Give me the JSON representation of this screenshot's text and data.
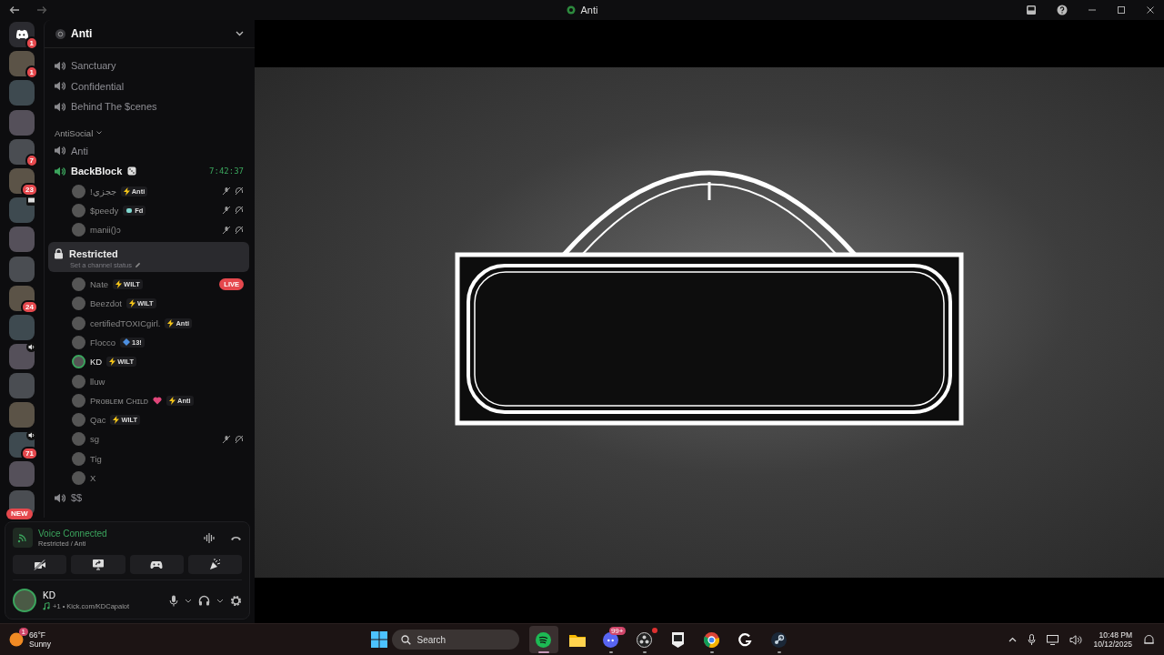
{
  "window": {
    "title": "Anti"
  },
  "servers": [
    {
      "kind": "home",
      "badge": "1",
      "speaker": false,
      "screen": false
    },
    {
      "kind": "server",
      "badge": "1",
      "speaker": false,
      "screen": false
    },
    {
      "kind": "server",
      "speaker": false,
      "screen": false
    },
    {
      "kind": "server",
      "speaker": false,
      "screen": false
    },
    {
      "kind": "server",
      "badge": "7",
      "speaker": false,
      "screen": false
    },
    {
      "kind": "server",
      "badge": "23",
      "speaker": false,
      "screen": false
    },
    {
      "kind": "server",
      "speaker": false,
      "screen": true
    },
    {
      "kind": "server",
      "speaker": false,
      "screen": false
    },
    {
      "kind": "server",
      "speaker": false,
      "screen": false
    },
    {
      "kind": "server",
      "badge": "24",
      "speaker": false,
      "screen": false
    },
    {
      "kind": "server",
      "speaker": false,
      "screen": false
    },
    {
      "kind": "server",
      "speaker": true,
      "screen": false
    },
    {
      "kind": "server",
      "speaker": false,
      "screen": false
    },
    {
      "kind": "server",
      "speaker": false,
      "screen": false
    },
    {
      "kind": "server",
      "badge": "71",
      "speaker": true,
      "screen": false
    },
    {
      "kind": "server",
      "speaker": false,
      "screen": false
    },
    {
      "kind": "server",
      "speaker": false,
      "screen": false,
      "tag": "NEW"
    }
  ],
  "server_header": {
    "name": "Anti"
  },
  "channels": [
    {
      "kind": "voice",
      "name": "Sanctuary",
      "selected": false,
      "active": false,
      "locked": false,
      "die": false
    },
    {
      "kind": "voice",
      "name": "Confidential",
      "selected": false,
      "active": false,
      "locked": false,
      "die": false
    },
    {
      "kind": "voice",
      "name": "Behind The $cenes",
      "selected": false,
      "active": false,
      "locked": false,
      "die": false
    },
    {
      "kind": "category",
      "name": "AntiSocial"
    },
    {
      "kind": "voice",
      "name": "Anti",
      "selected": false,
      "active": false,
      "locked": false,
      "die": false
    },
    {
      "kind": "voice",
      "name": "BackBlock",
      "timer": "7:42:37",
      "selected": false,
      "active": true,
      "locked": false,
      "die": true,
      "users": [
        {
          "name": "!ججزي",
          "tag": {
            "kind": "bolt",
            "text": "Anti"
          },
          "muted": true,
          "speaking": false,
          "heart": false
        },
        {
          "name": "$peedy",
          "tag": {
            "kind": "hand",
            "text": "Fd"
          },
          "muted": true,
          "speaking": false,
          "heart": false
        },
        {
          "name": "manii()ɔ",
          "muted": true,
          "speaking": false,
          "heart": false
        }
      ]
    },
    {
      "kind": "voice",
      "name": "Restricted",
      "status_hint": "Set a channel status",
      "selected": true,
      "active": false,
      "locked": true,
      "die": false,
      "users": [
        {
          "name": "Nate",
          "tag": {
            "kind": "bolt",
            "text": "WILT"
          },
          "status": "LIVE",
          "muted": false,
          "speaking": false,
          "heart": false
        },
        {
          "name": "Beezdot",
          "tag": {
            "kind": "bolt",
            "text": "WILT"
          },
          "muted": false,
          "speaking": false,
          "heart": false
        },
        {
          "name": "certifiedTOXICgirl.",
          "tag": {
            "kind": "bolt",
            "text": "Anti"
          },
          "muted": false,
          "speaking": false,
          "heart": false
        },
        {
          "name": "Flocco",
          "tag": {
            "kind": "diamond",
            "text": "13!"
          },
          "muted": false,
          "speaking": false,
          "heart": false
        },
        {
          "name": "KD",
          "tag": {
            "kind": "bolt",
            "text": "WILT"
          },
          "muted": false,
          "speaking": true,
          "heart": false
        },
        {
          "name": "lluw",
          "muted": false,
          "speaking": false,
          "heart": false
        },
        {
          "name": "Pʀᴏʙʟᴇᴍ Cʜɪʟᴅ",
          "tag": {
            "kind": "bolt",
            "text": "Anti"
          },
          "muted": false,
          "speaking": false,
          "heart": true
        },
        {
          "name": "Qac",
          "tag": {
            "kind": "bolt",
            "text": "WILT"
          },
          "muted": false,
          "speaking": false,
          "heart": false
        },
        {
          "name": "sg",
          "muted": true,
          "speaking": false,
          "heart": false
        },
        {
          "name": "Tig",
          "muted": false,
          "speaking": false,
          "heart": false
        },
        {
          "name": "X",
          "muted": false,
          "speaking": false,
          "heart": false
        }
      ]
    },
    {
      "kind": "voice",
      "name": "$$",
      "selected": false,
      "active": false,
      "locked": false,
      "die": false
    }
  ],
  "voice_panel": {
    "status": "Voice Connected",
    "location": "Restricted / Anti",
    "buttons": [
      {
        "kind": "camera"
      },
      {
        "kind": "screen"
      },
      {
        "kind": "game"
      },
      {
        "kind": "activity"
      }
    ]
  },
  "user_panel": {
    "name": "KD",
    "activity": "+1 • Kick.com/KDCapalot"
  },
  "taskbar": {
    "weather": {
      "temp": "66°F",
      "condition": "Sunny",
      "badge": "1"
    },
    "search": {
      "placeholder": "Search"
    },
    "apps": [
      {
        "kind": "spotify",
        "dot": false,
        "running": true,
        "focused": true
      },
      {
        "kind": "folder",
        "dot": false,
        "running": false,
        "focused": false
      },
      {
        "kind": "discord",
        "badge": "99+",
        "dot": false,
        "running": true,
        "focused": false
      },
      {
        "kind": "obs",
        "dot": true,
        "running": true,
        "focused": false
      },
      {
        "kind": "epic",
        "dot": false,
        "running": false,
        "focused": false
      },
      {
        "kind": "chrome",
        "dot": false,
        "running": true,
        "focused": false
      },
      {
        "kind": "g",
        "dot": false,
        "running": false,
        "focused": false
      },
      {
        "kind": "steam",
        "dot": false,
        "running": true,
        "focused": false
      }
    ],
    "time": "10:48 PM",
    "date": "10/12/2025"
  }
}
